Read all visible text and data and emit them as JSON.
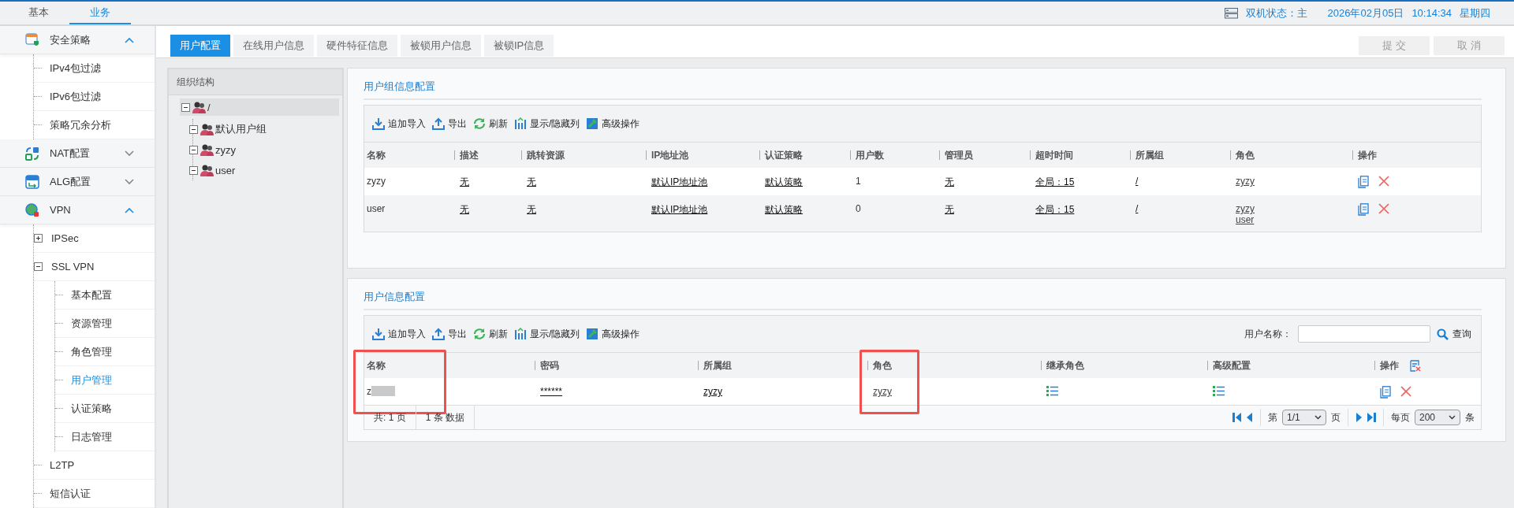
{
  "top_tabs": [
    {
      "label": "基本",
      "selected": false
    },
    {
      "label": "业务",
      "selected": true
    }
  ],
  "status": {
    "ha_state": "双机状态：主",
    "date": "2026年02月05日",
    "time": "10:14:34",
    "weekday": "星期四"
  },
  "sidebar": {
    "items": [
      {
        "label": "安全策略",
        "expanded": true,
        "children": [
          {
            "kind": "leaf",
            "label": "IPv4包过滤",
            "selected": false
          },
          {
            "kind": "leaf",
            "label": "IPv6包过滤",
            "selected": false
          },
          {
            "kind": "leaf",
            "label": "策略冗余分析",
            "selected": false
          }
        ]
      },
      {
        "label": "NAT配置",
        "expanded": false
      },
      {
        "label": "ALG配置",
        "expanded": false
      },
      {
        "label": "VPN",
        "expanded": true,
        "children": [
          {
            "kind": "folder",
            "label": "IPSec",
            "expanded": false
          },
          {
            "kind": "folder",
            "label": "SSL VPN",
            "expanded": true,
            "children": [
              {
                "label": "基本配置",
                "selected": false
              },
              {
                "label": "资源管理",
                "selected": false
              },
              {
                "label": "角色管理",
                "selected": false
              },
              {
                "label": "用户管理",
                "selected": true
              },
              {
                "label": "认证策略",
                "selected": false
              },
              {
                "label": "日志管理",
                "selected": false
              }
            ]
          },
          {
            "kind": "leaf",
            "label": "L2TP",
            "selected": false
          },
          {
            "kind": "leaf",
            "label": "短信认证",
            "selected": false
          }
        ]
      }
    ]
  },
  "sub_tabs": [
    {
      "label": "用户配置",
      "selected": true
    },
    {
      "label": "在线用户信息",
      "selected": false
    },
    {
      "label": "硬件特征信息",
      "selected": false
    },
    {
      "label": "被锁用户信息",
      "selected": false
    },
    {
      "label": "被锁IP信息",
      "selected": false
    }
  ],
  "buttons": [
    {
      "label": "提 交",
      "disabled": true
    },
    {
      "label": "取 消",
      "disabled": true
    }
  ],
  "org_tree": {
    "title": "组织结构",
    "root": {
      "label": "/",
      "expanded": true,
      "selected": true,
      "children": [
        {
          "label": "默认用户组"
        },
        {
          "label": "zyzy"
        },
        {
          "label": "user"
        }
      ]
    }
  },
  "group_panel": {
    "title": "用户组信息配置",
    "toolbar": [
      "追加导入",
      "导出",
      "刷新",
      "显示/隐藏列",
      "高级操作"
    ],
    "columns": [
      "名称",
      "描述",
      "跳转资源",
      "IP地址池",
      "认证策略",
      "用户数",
      "管理员",
      "超时时间",
      "所属组",
      "角色",
      "操作"
    ],
    "rows": [
      [
        {
          "kind": "text",
          "text": "zyzy"
        },
        {
          "kind": "link",
          "text": "无"
        },
        {
          "kind": "link",
          "text": "无"
        },
        {
          "kind": "link",
          "text": "默认IP地址池"
        },
        {
          "kind": "link",
          "text": "默认策略"
        },
        {
          "kind": "text",
          "text": "1"
        },
        {
          "kind": "link",
          "text": "无"
        },
        {
          "kind": "link",
          "text": "全局：15"
        },
        {
          "kind": "link",
          "text": "/"
        },
        {
          "kind": "links",
          "items": [
            "zyzy"
          ]
        },
        {
          "kind": "actions"
        }
      ],
      [
        {
          "kind": "text",
          "text": "user"
        },
        {
          "kind": "link",
          "text": "无"
        },
        {
          "kind": "link",
          "text": "无"
        },
        {
          "kind": "link",
          "text": "默认IP地址池"
        },
        {
          "kind": "link",
          "text": "默认策略"
        },
        {
          "kind": "text",
          "text": "0"
        },
        {
          "kind": "link",
          "text": "无"
        },
        {
          "kind": "link",
          "text": "全局：15"
        },
        {
          "kind": "link",
          "text": "/"
        },
        {
          "kind": "links",
          "items": [
            "zyzy",
            "user"
          ]
        },
        {
          "kind": "actions"
        }
      ]
    ]
  },
  "user_panel": {
    "title": "用户信息配置",
    "toolbar": [
      "追加导入",
      "导出",
      "刷新",
      "显示/隐藏列",
      "高级操作"
    ],
    "search": {
      "label": "用户名称：",
      "button": "查询"
    },
    "columns": [
      {
        "label": "名称",
        "highlighted": true
      },
      {
        "label": "密码",
        "highlighted": false
      },
      {
        "label": "所属组",
        "highlighted": false
      },
      {
        "label": "角色",
        "highlighted": true
      },
      {
        "label": "继承角色",
        "highlighted": false
      },
      {
        "label": "高级配置",
        "highlighted": false
      },
      {
        "label": "操作",
        "highlighted": false
      }
    ],
    "rows": [
      [
        {
          "kind": "redacted",
          "text": "z"
        },
        {
          "kind": "link",
          "text": "******"
        },
        {
          "kind": "link",
          "text": "zyzy"
        },
        {
          "kind": "links",
          "items": [
            "zyzy"
          ]
        },
        {
          "kind": "list-icon"
        },
        {
          "kind": "list-icon"
        },
        {
          "kind": "actions"
        }
      ]
    ],
    "footer": {
      "pages": "共: 1 页",
      "records": "1 条 数据",
      "page_prefix": "第",
      "page": "1/1",
      "page_suffix": "页",
      "per_page_prefix": "每页",
      "per_page": "200",
      "per_page_suffix": "条"
    }
  }
}
